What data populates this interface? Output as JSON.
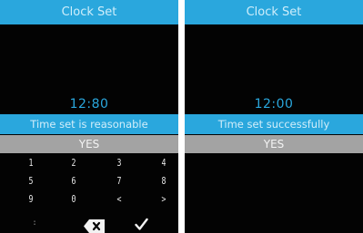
{
  "screens": [
    {
      "title": "Clock Set",
      "time": "12:80",
      "status": "Time set is reasonable",
      "confirm_label": "YES",
      "keypad": {
        "row1": [
          "1",
          "2",
          "3",
          "4"
        ],
        "row2": [
          "5",
          "6",
          "7",
          "8"
        ],
        "row3": [
          "9",
          "0",
          "<",
          ">"
        ],
        "row4": [
          ":",
          "backspace-icon",
          "checkmark-icon"
        ]
      }
    },
    {
      "title": "Clock Set",
      "time": "12:00",
      "status": "Time set successfully",
      "confirm_label": "YES"
    }
  ],
  "colors": {
    "accent": "#2aa7dd",
    "screen_background": "#030303",
    "yes_bar": "#a3a3a3"
  }
}
